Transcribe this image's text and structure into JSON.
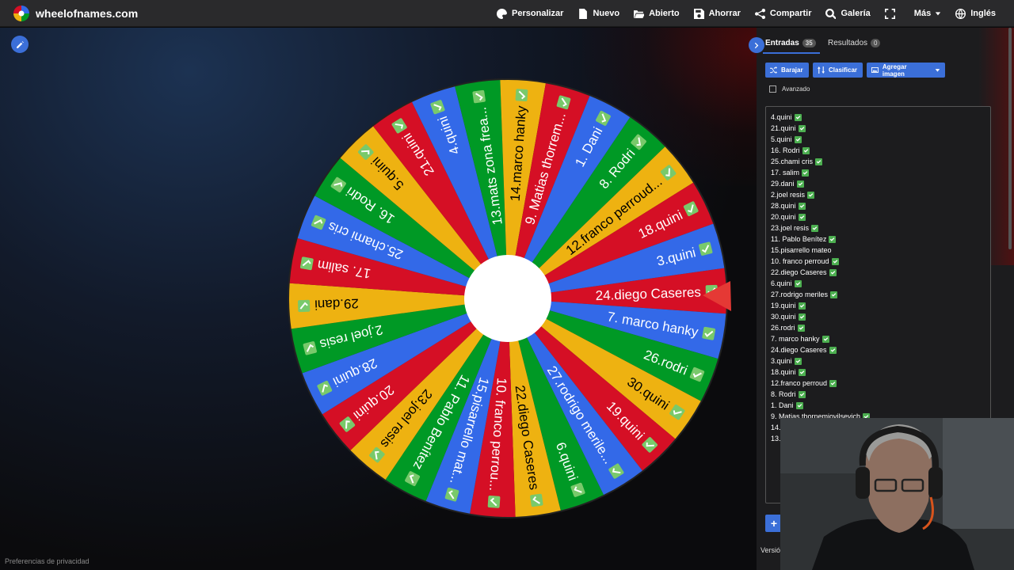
{
  "app": {
    "site_name": "wheelofnames.com"
  },
  "nav": [
    {
      "label": "Personalizar",
      "icon": "palette-icon"
    },
    {
      "label": "Nuevo",
      "icon": "file-icon"
    },
    {
      "label": "Abierto",
      "icon": "folder-open-icon"
    },
    {
      "label": "Ahorrar",
      "icon": "save-icon"
    },
    {
      "label": "Compartir",
      "icon": "share-icon"
    },
    {
      "label": "Galería",
      "icon": "search-icon"
    },
    {
      "label": "",
      "icon": "fullscreen-icon"
    },
    {
      "label": "Más",
      "icon": "caret-down-icon"
    },
    {
      "label": "Inglés",
      "icon": "globe-icon"
    }
  ],
  "wheel": {
    "colors": [
      "#3369e8",
      "#d50f25",
      "#eeb211",
      "#009925"
    ],
    "pointer_color": "#e53935",
    "segments": [
      "24.diego Caseres",
      "7. marco hanky",
      "26.rodri",
      "30.quini",
      "19.quini",
      "27.rodrigo merile...",
      "6.quini",
      "22.diego Caseres",
      "10. franco perrou...",
      "15.pisarrello mat...",
      "11. Pablo Benítez",
      "23.joel resis",
      "20.quini",
      "28.quini",
      "2.joel resis",
      "29.dani",
      "17. salim",
      "25.chami cris",
      "16. Rodri",
      "5.quini",
      "21.quini",
      "4.quini",
      "13.mats zona frea...",
      "14.marco hanky",
      "9. Matias thorrem...",
      "1. Dani",
      "8. Rodri",
      "12.franco perroud...",
      "18.quini",
      "3.quini"
    ]
  },
  "panel": {
    "tab_entries": "Entradas",
    "tab_entries_count": "35",
    "tab_results": "Resultados",
    "tab_results_count": "0",
    "btn_shuffle": "Barajar",
    "btn_sort": "Clasificar",
    "btn_image": "Agregar imagen",
    "advanced_label": "Avanzado",
    "add_label": "+",
    "version_label": "Versió"
  },
  "entries": [
    "4.quini",
    "21.quini",
    "5.quini",
    "16. Rodri",
    "25.chami cris",
    "17. salim",
    "29.dani",
    "2.joel resis",
    "28.quini",
    "20.quini",
    "23.joel resis",
    "11. Pablo Benítez",
    "15.pisarrello mateo",
    "10. franco perroud",
    "22.diego Caseres",
    "6.quini",
    "27.rodrigo meriles",
    "19.quini",
    "30.quini",
    "26.rodri",
    "7. marco hanky",
    "24.diego Caseres",
    "3.quini",
    "18.quini",
    "12.franco perroud",
    "8. Rodri",
    "1. Dani",
    "9. Matias thornemiovilsevich",
    "14.",
    "13."
  ],
  "entries_checked": [
    true,
    true,
    true,
    true,
    true,
    true,
    true,
    true,
    true,
    true,
    true,
    true,
    false,
    true,
    true,
    true,
    true,
    true,
    true,
    true,
    true,
    true,
    true,
    true,
    true,
    true,
    true,
    true,
    false,
    false
  ],
  "footer": {
    "privacy": "Preferencias de privacidad"
  }
}
